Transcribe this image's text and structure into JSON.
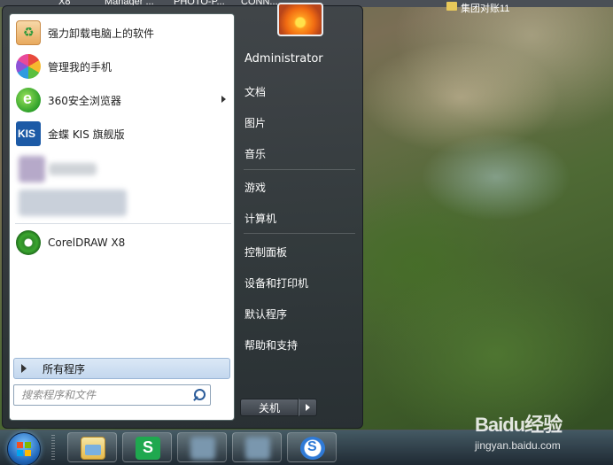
{
  "desktop": {
    "top_labels": [
      "X8",
      "Manager ...",
      "PHOTO-P...",
      "CONN..."
    ],
    "folder_label": "集团对账11"
  },
  "start_menu": {
    "programs": [
      {
        "label": "强力卸载电脑上的软件",
        "icon": "uninstall-icon"
      },
      {
        "label": "管理我的手机",
        "icon": "phone-manager-icon"
      },
      {
        "label": "360安全浏览器",
        "icon": "browser-360-icon",
        "has_submenu": true
      },
      {
        "label": "金蝶 KIS 旗舰版",
        "icon": "kis-icon"
      },
      {
        "label": "CorelDRAW X8",
        "icon": "coreldraw-icon"
      }
    ],
    "all_programs": "所有程序",
    "search_placeholder": "搜索程序和文件",
    "right_items": {
      "user": "Administrator",
      "documents": "文档",
      "pictures": "图片",
      "music": "音乐",
      "games": "游戏",
      "computer": "计算机",
      "control_panel": "控制面板",
      "devices_printers": "设备和打印机",
      "default_programs": "默认程序",
      "help_support": "帮助和支持"
    },
    "shutdown_label": "关机"
  },
  "taskbar": {
    "icons": [
      "windows-start-icon",
      "file-explorer-icon",
      "wps-spreadsheet-icon",
      "blurred-app-icon",
      "blurred-app-icon",
      "sogou-icon"
    ]
  },
  "watermark": {
    "brand": "Baidu经验",
    "url": "jingyan.baidu.com"
  }
}
